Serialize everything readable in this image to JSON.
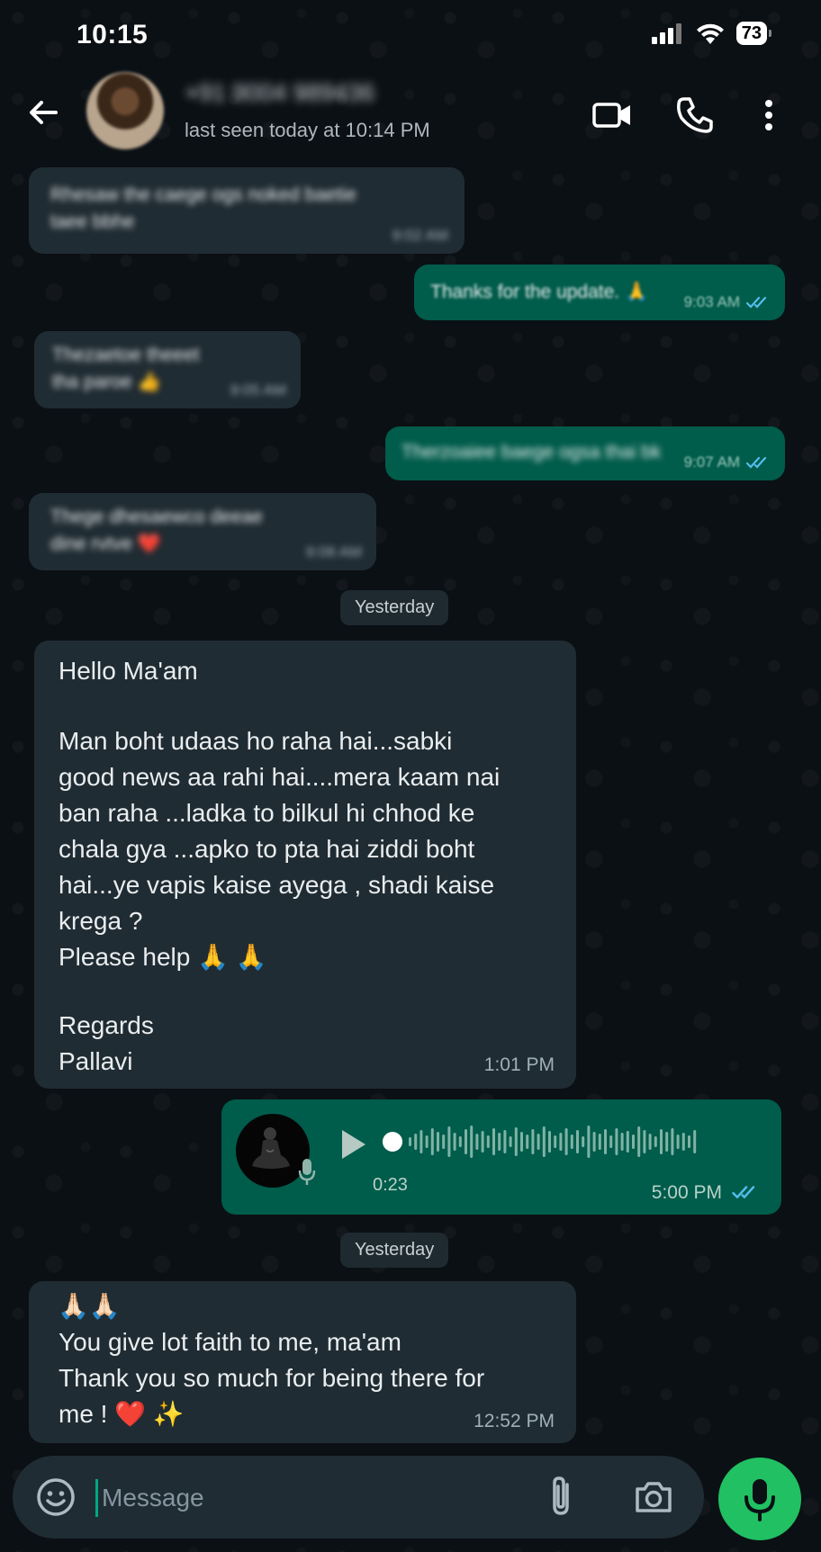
{
  "status_bar": {
    "time": "10:15",
    "battery": "73"
  },
  "header": {
    "contact_name": "+91 9004 989436",
    "last_seen": "last seen today at 10:14 PM"
  },
  "messages": [
    {
      "dir": "in",
      "text": "Rhesaw the caege ogs noked baetie taee bbhe",
      "time": "9:02 AM"
    },
    {
      "dir": "out",
      "text": "Thanks for the update. 🙏",
      "time": "9:03 AM"
    },
    {
      "dir": "in",
      "text": "Thezaetoe theeet tha paroe 👍",
      "time": "9:05 AM"
    },
    {
      "dir": "out",
      "text": "Therzoaiee baege ogsa thai bk",
      "time": "9:07 AM"
    },
    {
      "dir": "in",
      "text": "Thege dhesaewco deeae dine rvtve ❤️",
      "time": "9:08 AM"
    }
  ],
  "date_chip_1": "Yesterday",
  "long_message": {
    "greeting": "Hello Ma'am",
    "body": "Man boht udaas ho raha hai...sabki\ngood news aa rahi hai....mera kaam nai\nban raha ...ladka to bilkul hi chhod ke\nchala gya ...apko to pta hai ziddi boht\nhai...ye vapis kaise ayega , shadi kaise\nkrega ?\nPlease help 🙏 🙏",
    "signoff": "Regards\nPallavi",
    "time": "1:01 PM"
  },
  "voice_note": {
    "duration": "0:23",
    "time": "5:00 PM"
  },
  "date_chip_2": "Yesterday",
  "last_message": {
    "emoji": "🙏🏻🙏🏻",
    "text": "You give lot faith to me, ma'am\nThank you so much for being there for\nme ! ❤️ ✨",
    "time": "12:52 PM"
  },
  "input": {
    "placeholder": "Message"
  },
  "colors": {
    "incoming": "#202c33",
    "outgoing": "#005c4b",
    "accent": "#21c063",
    "read_tick": "#53bdeb"
  }
}
